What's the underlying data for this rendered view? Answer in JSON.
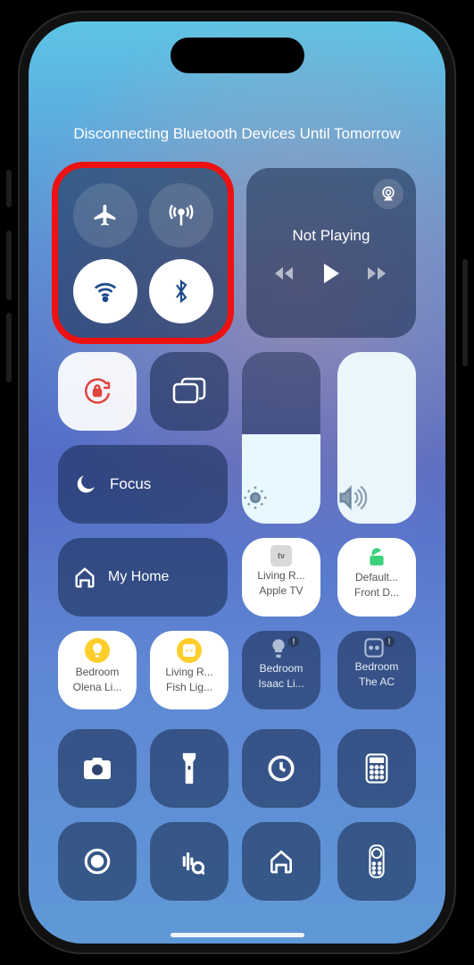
{
  "status_message": "Disconnecting Bluetooth Devices Until Tomorrow",
  "connectivity": {
    "airplane": {
      "on": false
    },
    "cellular": {
      "on": false
    },
    "wifi": {
      "on": true
    },
    "bluetooth": {
      "on": true
    }
  },
  "media": {
    "now_playing": "Not Playing"
  },
  "focus": {
    "label": "Focus"
  },
  "orientation_lock": {
    "color": "#e0443d"
  },
  "brightness": {
    "level_pct": 52
  },
  "volume": {
    "level_pct": 100
  },
  "home": {
    "label": "My Home",
    "tiles_row1": [
      {
        "line1": "Living R...",
        "line2": "Apple TV",
        "icon": "appletv",
        "bg": "light"
      },
      {
        "line1": "Default...",
        "line2": "Front D...",
        "icon": "unlock",
        "bg": "light",
        "icon_color": "#3ad27a"
      }
    ],
    "tiles_row2": [
      {
        "line1": "Bedroom",
        "line2": "Olena Li...",
        "icon": "bulb",
        "bg": "light",
        "icon_color": "#ffce2b"
      },
      {
        "line1": "Living R...",
        "line2": "Fish Lig...",
        "icon": "outlet",
        "bg": "light",
        "icon_color": "#ffce2b"
      },
      {
        "line1": "Bedroom",
        "line2": "Isaac Li...",
        "icon": "bulb",
        "bg": "dark",
        "badge": true
      },
      {
        "line1": "Bedroom",
        "line2": "The AC",
        "icon": "outlet",
        "bg": "dark",
        "badge": true
      }
    ]
  },
  "shortcuts": [
    [
      "camera",
      "flashlight",
      "timer",
      "calculator"
    ],
    [
      "screen-record",
      "shazam",
      "home",
      "remote"
    ]
  ]
}
